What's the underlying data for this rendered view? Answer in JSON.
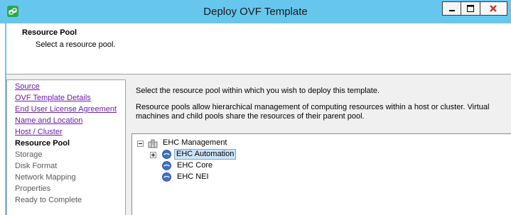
{
  "window": {
    "title": "Deploy OVF Template",
    "app_icon": "vsphere-link-icon",
    "controls": [
      "minimize-icon",
      "maximize-icon",
      "close-icon"
    ]
  },
  "header": {
    "title": "Resource Pool",
    "subtitle": "Select a resource pool."
  },
  "nav": {
    "items": [
      {
        "label": "Source",
        "state": "completed"
      },
      {
        "label": "OVF Template Details",
        "state": "completed"
      },
      {
        "label": "End User License Agreement",
        "state": "completed"
      },
      {
        "label": "Name and Location",
        "state": "completed"
      },
      {
        "label": "Host / Cluster",
        "state": "completed"
      },
      {
        "label": "Resource Pool",
        "state": "current"
      },
      {
        "label": "Storage",
        "state": "pending"
      },
      {
        "label": "Disk Format",
        "state": "pending"
      },
      {
        "label": "Network Mapping",
        "state": "pending"
      },
      {
        "label": "Properties",
        "state": "pending"
      },
      {
        "label": "Ready to Complete",
        "state": "pending"
      }
    ]
  },
  "main": {
    "instruction": "Select the resource pool within which you wish to deploy this template.",
    "description": "Resource pools allow hierarchical management of computing resources within a host or cluster. Virtual machines and child pools share the resources of their parent pool."
  },
  "tree": {
    "root": {
      "label": "EHC Management",
      "icon": "cluster-icon",
      "expanded": true
    },
    "children": [
      {
        "label": "EHC Automation",
        "icon": "resource-pool-icon",
        "expandable": true,
        "selected": true
      },
      {
        "label": "EHC Core",
        "icon": "resource-pool-icon",
        "expandable": false,
        "selected": false
      },
      {
        "label": "EHC NEI",
        "icon": "resource-pool-icon",
        "expandable": false,
        "selected": false
      }
    ]
  },
  "colors": {
    "titlebar": "#67c6ee",
    "link": "#6a1fa0",
    "selection": "#cce4f7",
    "close_icon": "#c0392b"
  }
}
